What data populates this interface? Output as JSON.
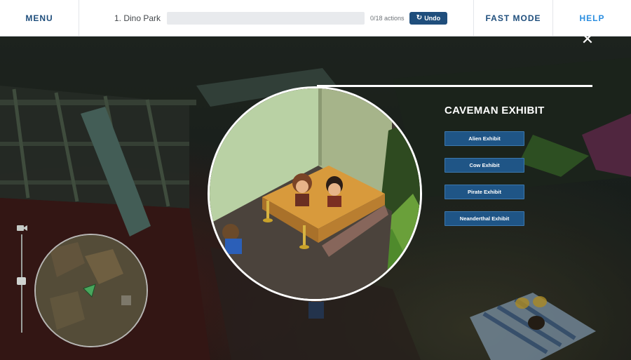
{
  "topbar": {
    "menu_label": "MENU",
    "level_name": "1. Dino Park",
    "progress_fraction": 0.0,
    "actions_count": "0/18 actions",
    "undo_label": "Undo",
    "fast_mode_label": "FAST MODE",
    "help_label": "HELP"
  },
  "panel": {
    "title": "CAVEMAN EXHIBIT",
    "options": [
      {
        "label": "Alien Exhibit"
      },
      {
        "label": "Cow Exhibit"
      },
      {
        "label": "Pirate Exhibit"
      },
      {
        "label": "Neanderthal Exhibit"
      }
    ],
    "close_icon": "close-icon"
  },
  "colors": {
    "primary": "#1f4e7c",
    "help": "#2a8ee0",
    "button": "#1f5586"
  }
}
